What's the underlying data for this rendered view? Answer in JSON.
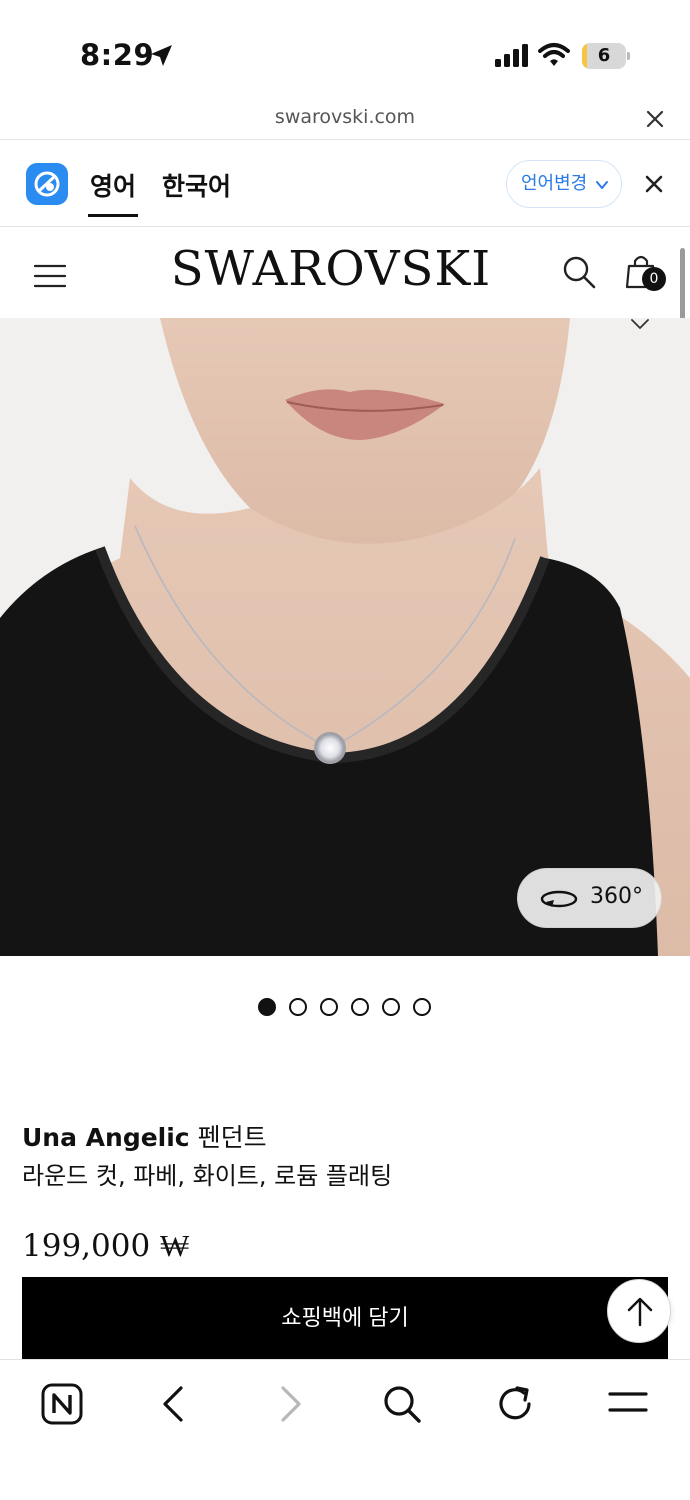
{
  "status_bar": {
    "time": "8:29",
    "battery_level": "6",
    "battery_fraction": 0.12,
    "battery_color": "#f5c542"
  },
  "url_bar": {
    "domain": "swarovski.com",
    "close_icon": "close-icon"
  },
  "translate_bar": {
    "tabs": [
      {
        "label": "영어",
        "active": true
      },
      {
        "label": "한국어",
        "active": false
      }
    ],
    "change_language_label": "언어변경",
    "accent_color": "#2a8cf0"
  },
  "header": {
    "logo": "SWAROVSKI",
    "cart_count": "0",
    "icons": [
      "hamburger-menu-icon",
      "search-icon",
      "shopping-bag-icon"
    ]
  },
  "gallery": {
    "button_360_label": "360°",
    "image_count": 6,
    "active_index": 0
  },
  "product": {
    "brand": "Una Angelic",
    "type": " 펜던트",
    "description": "라운드 컷, 파베, 화이트, 로듐 플래팅",
    "price": "199,000 ₩",
    "add_to_bag_label": "쇼핑백에 담기"
  },
  "browser_toolbar": {
    "items": [
      "naver-home-icon",
      "back-icon",
      "forward-icon",
      "search-icon",
      "reload-icon",
      "menu-icon"
    ]
  }
}
